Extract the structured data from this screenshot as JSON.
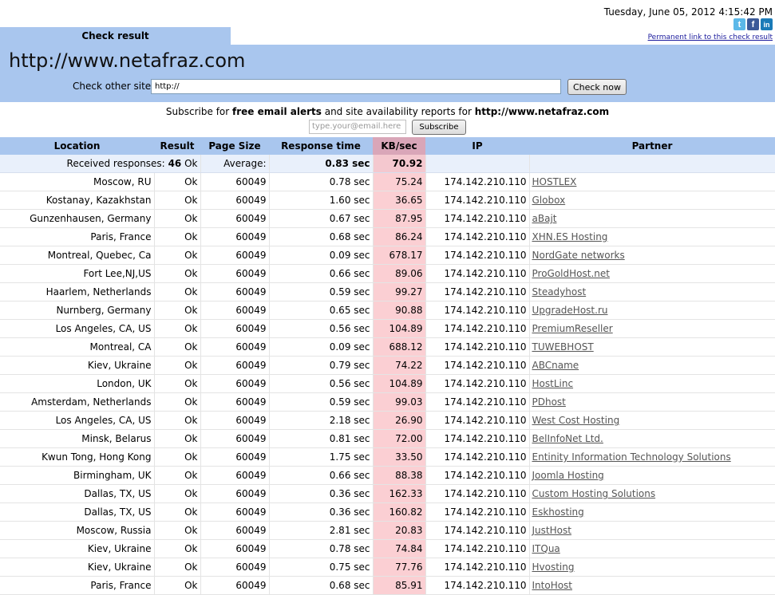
{
  "header": {
    "datetime": "Tuesday, June 05, 2012 4:15:42 PM",
    "permalink": "Permanent link to this check result",
    "tab_title": "Check result",
    "site_url": "http://www.netafraz.com",
    "check_label": "Check other site:",
    "check_input_value": "http://",
    "check_button": "Check now"
  },
  "social": {
    "twitter": "t",
    "facebook": "f",
    "linkedin": "in"
  },
  "subscribe": {
    "text_prefix": "Subscribe for ",
    "text_bold1": "free email alerts",
    "text_mid": " and site availability reports for ",
    "text_bold2": "http://www.netafraz.com",
    "email_placeholder": "type.your@email.here",
    "button": "Subscribe"
  },
  "table": {
    "headers": [
      "Location",
      "Result",
      "Page Size",
      "Response time",
      "KB/sec",
      "IP",
      "Partner"
    ],
    "summary": {
      "received_label": "Received responses:",
      "received_count": "46",
      "received_status": "Ok",
      "average_label": "Average:",
      "avg_time": "0.83 sec",
      "avg_kb": "70.92"
    },
    "rows": [
      [
        "Moscow, RU",
        "Ok",
        "60049",
        "0.78 sec",
        "75.24",
        "174.142.210.110",
        "HOSTLEX"
      ],
      [
        "Kostanay, Kazakhstan",
        "Ok",
        "60049",
        "1.60 sec",
        "36.65",
        "174.142.210.110",
        "Globox"
      ],
      [
        "Gunzenhausen, Germany",
        "Ok",
        "60049",
        "0.67 sec",
        "87.95",
        "174.142.210.110",
        "aBajt"
      ],
      [
        "Paris, France",
        "Ok",
        "60049",
        "0.68 sec",
        "86.24",
        "174.142.210.110",
        "XHN.ES Hosting"
      ],
      [
        "Montreal, Quebec, Ca",
        "Ok",
        "60049",
        "0.09 sec",
        "678.17",
        "174.142.210.110",
        "NordGate networks"
      ],
      [
        "Fort Lee,NJ,US",
        "Ok",
        "60049",
        "0.66 sec",
        "89.06",
        "174.142.210.110",
        "ProGoldHost.net"
      ],
      [
        "Haarlem, Netherlands",
        "Ok",
        "60049",
        "0.59 sec",
        "99.27",
        "174.142.210.110",
        "Steadyhost"
      ],
      [
        "Nurnberg, Germany",
        "Ok",
        "60049",
        "0.65 sec",
        "90.88",
        "174.142.210.110",
        "UpgradeHost.ru"
      ],
      [
        "Los Angeles, CA, US",
        "Ok",
        "60049",
        "0.56 sec",
        "104.89",
        "174.142.210.110",
        "PremiumReseller"
      ],
      [
        "Montreal, CA",
        "Ok",
        "60049",
        "0.09 sec",
        "688.12",
        "174.142.210.110",
        "TUWEBHOST"
      ],
      [
        "Kiev, Ukraine",
        "Ok",
        "60049",
        "0.79 sec",
        "74.22",
        "174.142.210.110",
        "ABCname"
      ],
      [
        "London, UK",
        "Ok",
        "60049",
        "0.56 sec",
        "104.89",
        "174.142.210.110",
        "HostLinc"
      ],
      [
        "Amsterdam, Netherlands",
        "Ok",
        "60049",
        "0.59 sec",
        "99.03",
        "174.142.210.110",
        "PDhost"
      ],
      [
        "Los Angeles, CA, US",
        "Ok",
        "60049",
        "2.18 sec",
        "26.90",
        "174.142.210.110",
        "West Cost Hosting"
      ],
      [
        "Minsk, Belarus",
        "Ok",
        "60049",
        "0.81 sec",
        "72.00",
        "174.142.210.110",
        "BelInfoNet Ltd."
      ],
      [
        "Kwun Tong, Hong Kong",
        "Ok",
        "60049",
        "1.75 sec",
        "33.50",
        "174.142.210.110",
        "Entinity Information Technology Solutions"
      ],
      [
        "Birmingham, UK",
        "Ok",
        "60049",
        "0.66 sec",
        "88.38",
        "174.142.210.110",
        "Joomla Hosting"
      ],
      [
        "Dallas, TX, US",
        "Ok",
        "60049",
        "0.36 sec",
        "162.33",
        "174.142.210.110",
        "Custom Hosting Solutions"
      ],
      [
        "Dallas, TX, US",
        "Ok",
        "60049",
        "0.36 sec",
        "160.82",
        "174.142.210.110",
        "Eskhosting"
      ],
      [
        "Moscow, Russia",
        "Ok",
        "60049",
        "2.81 sec",
        "20.83",
        "174.142.210.110",
        "JustHost"
      ],
      [
        "Kiev, Ukraine",
        "Ok",
        "60049",
        "0.78 sec",
        "74.84",
        "174.142.210.110",
        "ITQua"
      ],
      [
        "Kiev, Ukraine",
        "Ok",
        "60049",
        "0.75 sec",
        "77.76",
        "174.142.210.110",
        "Hvosting"
      ],
      [
        "Paris, France",
        "Ok",
        "60049",
        "0.68 sec",
        "85.91",
        "174.142.210.110",
        "IntoHost"
      ]
    ]
  }
}
